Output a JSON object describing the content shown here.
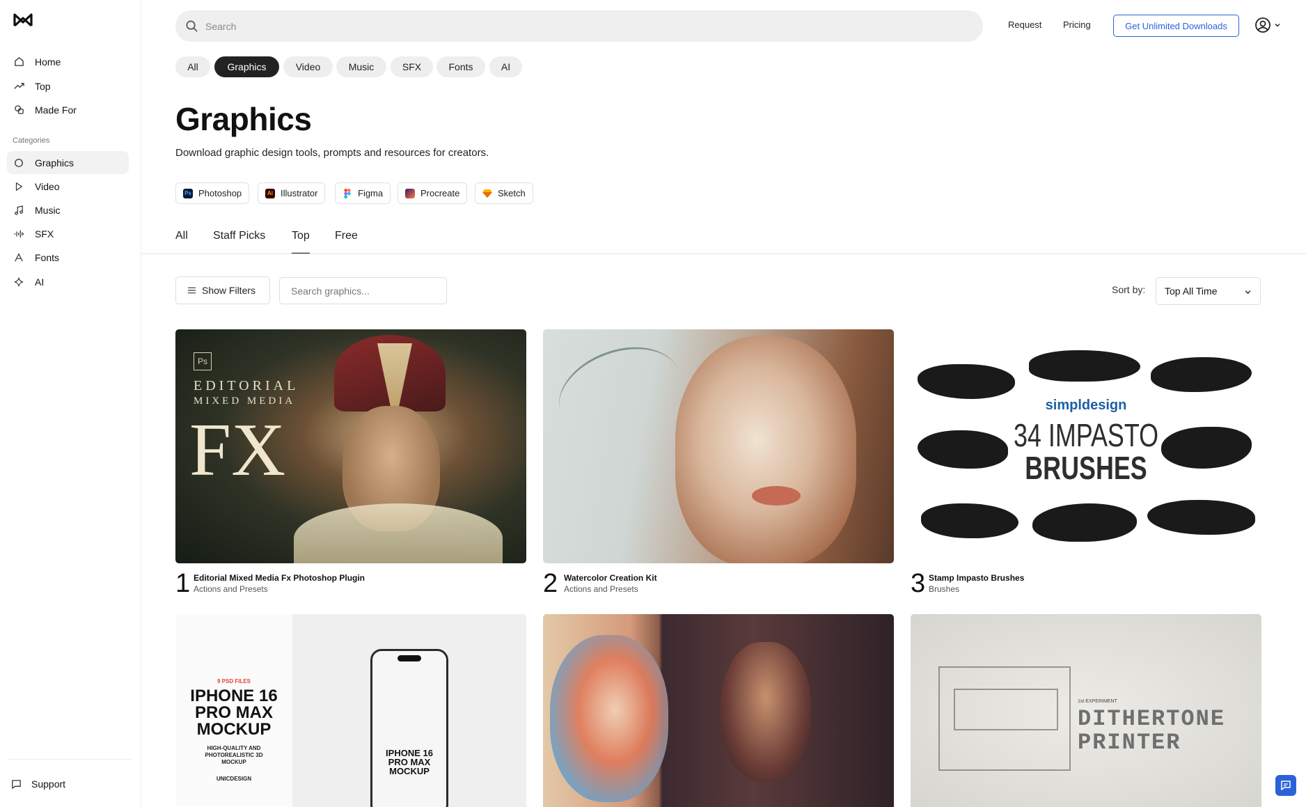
{
  "sidebar": {
    "nav": [
      {
        "label": "Home",
        "icon": "home-icon"
      },
      {
        "label": "Top",
        "icon": "trending-icon"
      },
      {
        "label": "Made For",
        "icon": "made-for-icon"
      }
    ],
    "categories_label": "Categories",
    "categories": [
      {
        "label": "Graphics",
        "icon": "circle-icon",
        "active": true
      },
      {
        "label": "Video",
        "icon": "play-icon"
      },
      {
        "label": "Music",
        "icon": "music-note-icon"
      },
      {
        "label": "SFX",
        "icon": "waveform-icon"
      },
      {
        "label": "Fonts",
        "icon": "font-a-icon"
      },
      {
        "label": "AI",
        "icon": "sparkle-icon"
      }
    ],
    "support": "Support"
  },
  "header": {
    "search_placeholder": "Search",
    "links": [
      "Request",
      "Pricing"
    ],
    "cta": "Get Unlimited Downloads"
  },
  "top_pills": [
    "All",
    "Graphics",
    "Video",
    "Music",
    "SFX",
    "Fonts",
    "AI"
  ],
  "active_pill": "Graphics",
  "page": {
    "title": "Graphics",
    "subtitle": "Download graphic design tools, prompts and resources for creators."
  },
  "apps": [
    {
      "label": "Photoshop",
      "abbr": "Ps",
      "color": "#0b1a3a",
      "fg": "#31a8ff"
    },
    {
      "label": "Illustrator",
      "abbr": "Ai",
      "color": "#330000",
      "fg": "#ff9a00"
    },
    {
      "label": "Figma",
      "abbr": "",
      "color": "#ffffff",
      "fg": "#f24e1e"
    },
    {
      "label": "Procreate",
      "abbr": "",
      "color": "#5a2a6a",
      "fg": "#ff8a3d"
    },
    {
      "label": "Sketch",
      "abbr": "",
      "color": "#fdb300",
      "fg": "#ea6c00"
    }
  ],
  "tabs": [
    "All",
    "Staff Picks",
    "Top",
    "Free"
  ],
  "active_tab": "Top",
  "filters": {
    "show_filters": "Show Filters",
    "search_placeholder": "Search graphics...",
    "sort_label": "Sort by:",
    "sort_value": "Top All Time"
  },
  "cards": [
    {
      "rank": "1",
      "title": "Editorial Mixed Media Fx Photoshop Plugin",
      "category": "Actions and Presets",
      "thumb_text": {
        "badge": "Ps",
        "line1": "EDITORIAL",
        "line2": "MIXED MEDIA",
        "big": "FX"
      }
    },
    {
      "rank": "2",
      "title": "Watercolor Creation Kit",
      "category": "Actions and Presets"
    },
    {
      "rank": "3",
      "title": "Stamp Impasto Brushes",
      "category": "Brushes",
      "thumb_text": {
        "brand": "simpldesign",
        "line1": "34 IMPASTO",
        "line2": "BRUSHES"
      }
    }
  ],
  "cards_row2": [
    {
      "thumb_text": {
        "tag": "9 PSD FILES",
        "l1": "IPHONE 16",
        "l2": "PRO MAX",
        "l3": "MOCKUP",
        "desc1": "HIGH-QUALITY AND",
        "desc2": "PHOTOREALISTIC 3D",
        "desc3": "MOCKUP",
        "brand": "UNICDESIGN",
        "phone1": "IPHONE 16",
        "phone2": "PRO MAX",
        "phone3": "MOCKUP"
      }
    },
    {
      "thumb_text": {}
    },
    {
      "thumb_text": {
        "small": "1st EXPERIMENT",
        "l1": "DITHERTONE",
        "l2": "PRINTER"
      }
    }
  ]
}
